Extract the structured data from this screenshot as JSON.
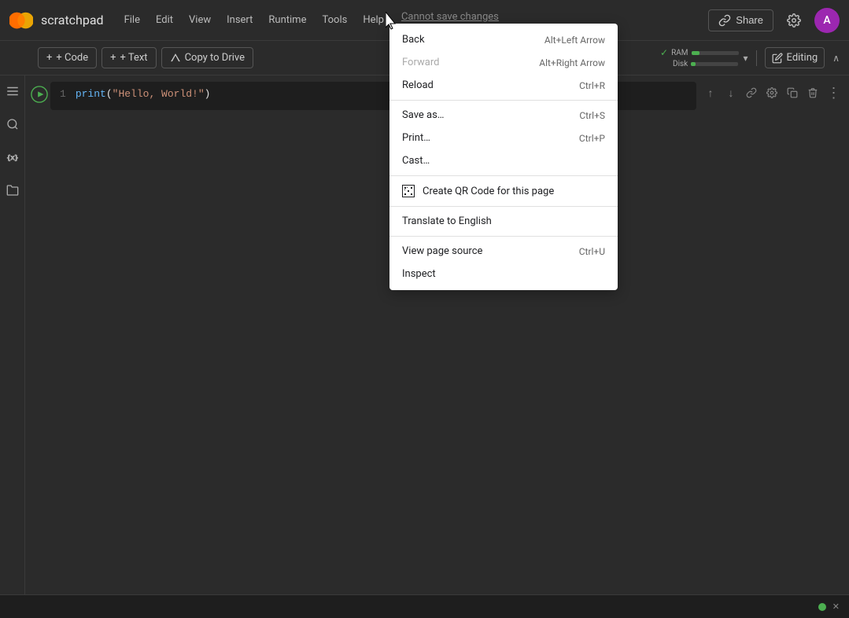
{
  "app": {
    "title": "scratchpad",
    "logo_colors": {
      "outer": "#FF6D00",
      "inner": "#FF6D00"
    }
  },
  "top_bar": {
    "menu_items": [
      "File",
      "Edit",
      "View",
      "Insert",
      "Runtime",
      "Tools",
      "Help"
    ],
    "cannot_save": "Cannot save changes",
    "share_label": "Share",
    "avatar_letter": "A"
  },
  "toolbar": {
    "add_code_label": "+ Code",
    "add_text_label": "+ Text",
    "copy_to_drive_label": "Copy to Drive",
    "ram_label": "RAM",
    "disk_label": "Disk",
    "ram_percent": 18,
    "disk_percent": 10,
    "editing_label": "Editing"
  },
  "cell": {
    "line_number": "1",
    "code": "print(\"Hello, World!\")",
    "code_parts": {
      "func": "print",
      "open_paren": "(",
      "string": "\"Hello, World!\"",
      "close_paren": ")"
    }
  },
  "cell_toolbar": {
    "up_icon": "↑",
    "down_icon": "↓",
    "link_icon": "🔗",
    "settings_icon": "⚙",
    "copy_icon": "⧉",
    "delete_icon": "🗑",
    "more_icon": "⋮"
  },
  "context_menu": {
    "items": [
      {
        "label": "Back",
        "shortcut": "Alt+Left Arrow",
        "disabled": false,
        "icon": null
      },
      {
        "label": "Forward",
        "shortcut": "Alt+Right Arrow",
        "disabled": true,
        "icon": null
      },
      {
        "label": "Reload",
        "shortcut": "Ctrl+R",
        "disabled": false,
        "icon": null
      },
      {
        "separator": true
      },
      {
        "label": "Save as…",
        "shortcut": "Ctrl+S",
        "disabled": false,
        "icon": null
      },
      {
        "label": "Print…",
        "shortcut": "Ctrl+P",
        "disabled": false,
        "icon": null
      },
      {
        "label": "Cast…",
        "shortcut": "",
        "disabled": false,
        "icon": null
      },
      {
        "separator": true
      },
      {
        "label": "Create QR Code for this page",
        "shortcut": "",
        "disabled": false,
        "icon": "qr"
      },
      {
        "separator": true
      },
      {
        "label": "Translate to English",
        "shortcut": "",
        "disabled": false,
        "icon": null
      },
      {
        "separator": true
      },
      {
        "label": "View page source",
        "shortcut": "Ctrl+U",
        "disabled": false,
        "icon": null
      },
      {
        "label": "Inspect",
        "shortcut": "",
        "disabled": false,
        "icon": null
      }
    ]
  },
  "sidebar": {
    "icons": [
      "≡",
      "🔍",
      "{x}",
      "□"
    ]
  },
  "bottom_bar": {
    "dot_color": "#4caf50",
    "x_label": "✕"
  }
}
